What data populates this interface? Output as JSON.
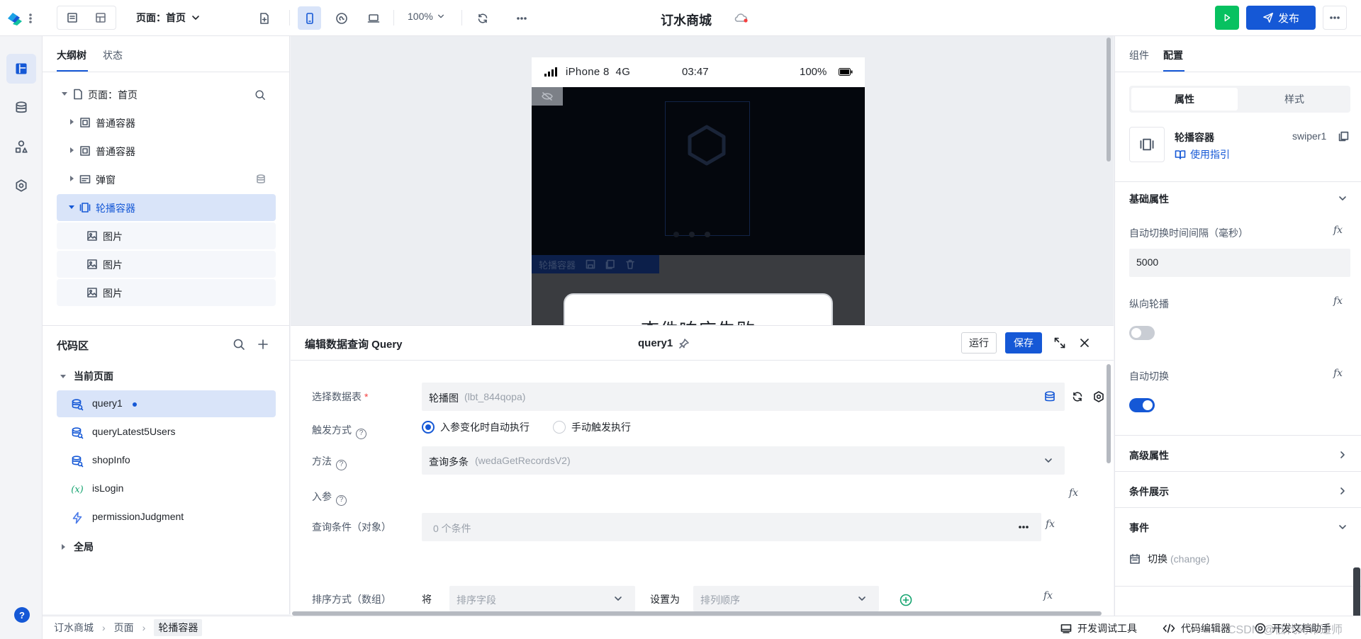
{
  "topbar": {
    "page_selector": "页面：首页",
    "zoom": "100%",
    "app_title": "订水商城",
    "publish_label": "发布"
  },
  "outline": {
    "tabs": [
      "大纲树",
      "状态"
    ],
    "tree": [
      {
        "label": "页面：首页"
      },
      {
        "label": "普通容器"
      },
      {
        "label": "普通容器"
      },
      {
        "label": "弹窗"
      },
      {
        "label": "轮播容器"
      },
      {
        "label": "图片"
      },
      {
        "label": "图片"
      },
      {
        "label": "图片"
      }
    ]
  },
  "codearea": {
    "title": "代码区",
    "current_page": "当前页面",
    "items": [
      {
        "label": "query1"
      },
      {
        "label": "queryLatest5Users"
      },
      {
        "label": "shopInfo"
      },
      {
        "label": "isLogin"
      },
      {
        "label": "permissionJudgment"
      }
    ],
    "global": "全局"
  },
  "phone": {
    "carrier": "iPhone 8  4G",
    "time": "03:47",
    "battery": "100%",
    "swiper_tag": "轮播容器",
    "card_text": "查件响应失败"
  },
  "editor": {
    "title": "编辑数据查询 Query",
    "query_name": "query1",
    "run_label": "运行",
    "save_label": "保存",
    "fields": {
      "table_label": "选择数据表",
      "table_value": "轮播图",
      "table_id": "(lbt_844qopa)",
      "trigger_label": "触发方式",
      "trigger_auto": "入参变化时自动执行",
      "trigger_manual": "手动触发执行",
      "method_label": "方法",
      "method_value": "查询多条",
      "method_id": "(wedaGetRecordsV2)",
      "params_label": "入参",
      "cond_label": "查询条件（对象）",
      "cond_value": "0 个条件",
      "sort_label": "排序方式（数组）",
      "sort_prefix": "将",
      "sort_field_placeholder": "排序字段",
      "sort_set": "设置为",
      "sort_order_placeholder": "排列顺序"
    }
  },
  "config": {
    "tabs": [
      "组件",
      "配置"
    ],
    "subtabs": [
      "属性",
      "样式"
    ],
    "component_name": "轮播容器",
    "component_id": "swiper1",
    "guide_link": "使用指引",
    "basic_title": "基础属性",
    "interval_label": "自动切换时间间隔（毫秒）",
    "interval_value": "5000",
    "vertical_label": "纵向轮播",
    "vertical_on": false,
    "autoplay_label": "自动切换",
    "autoplay_on": true,
    "advanced_title": "高级属性",
    "condition_title": "条件展示",
    "events_title": "事件",
    "event_name": "切换",
    "event_key": "(change)"
  },
  "statusbar": {
    "breadcrumb": [
      "订水商城",
      "页面",
      "轮播容器"
    ],
    "devtools": "开发调试工具",
    "code_editor": "代码编辑器",
    "dev_docs": "开发文档助手",
    "watermark": "CSDN @低代码布道师"
  },
  "colors": {
    "brand": "#1558d6",
    "run_green": "#07c160",
    "selected_bg": "#d9e4f9"
  }
}
